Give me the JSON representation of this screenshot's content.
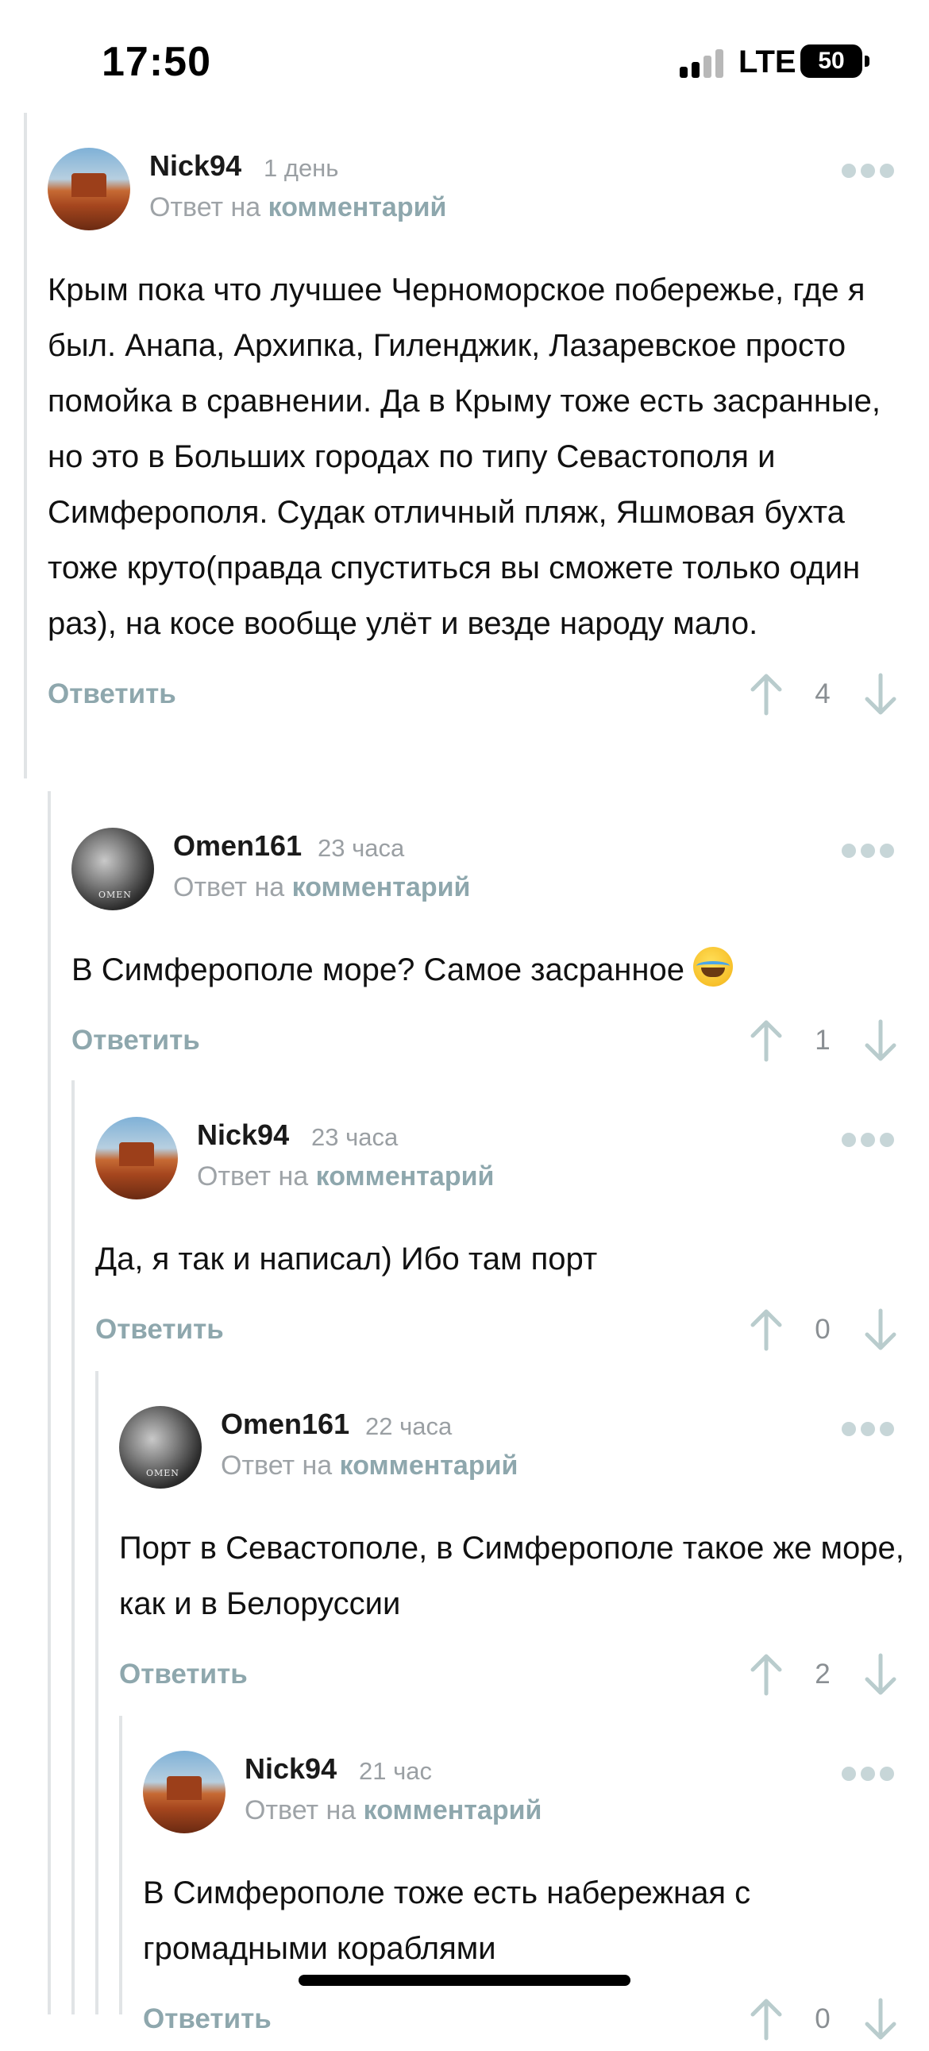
{
  "status_bar": {
    "time": "17:50",
    "network": "LTE",
    "battery": "50"
  },
  "comments": [
    {
      "username": "Nick94",
      "time_ago": "1 день",
      "reply_prefix": "Ответ на",
      "reply_link": "комментарий",
      "avatar": "desert-butte-avatar",
      "text": "Крым пока что лучшее Черноморское побережье, где я был. Анапа, Архипка, Гиленджик, Лазаревское просто помойка в сравнении. Да в Крыму тоже есть засранные, но это в Больших городах по типу Севастополя и Симферополя. Судак отличный пляж, Яшмовая бухта тоже круто(правда спуститься вы сможете только один раз), на косе вообще улёт и везде народу мало.",
      "reply_label": "Ответить",
      "votes": "4"
    },
    {
      "username": "Omen161",
      "time_ago": "23 часа",
      "reply_prefix": "Ответ на",
      "reply_link": "комментарий",
      "avatar": "omen-avatar",
      "text": "В Симферополе море? Самое засранное",
      "emoji": "laughing-tears-emoji",
      "reply_label": "Ответить",
      "votes": "1"
    },
    {
      "username": "Nick94",
      "time_ago": "23 часа",
      "reply_prefix": "Ответ на",
      "reply_link": "комментарий",
      "avatar": "desert-butte-avatar",
      "text": "Да, я так и написал) Ибо там порт",
      "reply_label": "Ответить",
      "votes": "0"
    },
    {
      "username": "Omen161",
      "time_ago": "22 часа",
      "reply_prefix": "Ответ на",
      "reply_link": "комментарий",
      "avatar": "omen-avatar",
      "text": "Порт в Севастополе, в Симферополе такое же море, как и в Белоруссии",
      "reply_label": "Ответить",
      "votes": "2"
    },
    {
      "username": "Nick94",
      "time_ago": "21 час",
      "reply_prefix": "Ответ на",
      "reply_link": "комментарий",
      "avatar": "desert-butte-avatar",
      "text": "В Симферополе тоже есть набережная с громадными кораблями",
      "reply_label": "Ответить",
      "votes": "0"
    }
  ],
  "colors": {
    "accent": "#8ea7ad",
    "muted": "#9ea3a7",
    "thread_line": "#e1e4e6",
    "vote_icon": "#b9cccd"
  }
}
